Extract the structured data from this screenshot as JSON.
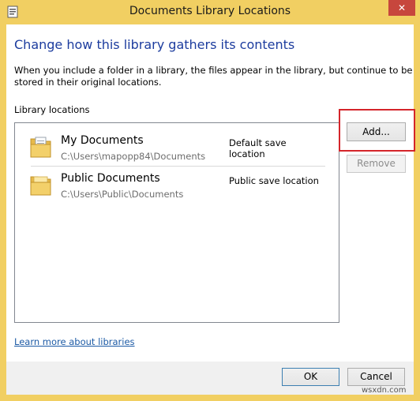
{
  "window": {
    "title": "Documents Library Locations",
    "close_glyph": "✕"
  },
  "heading": "Change how this library gathers its contents",
  "description": "When you include a folder in a library, the files appear in the library, but continue to be stored in their original locations.",
  "library_label": "Library locations",
  "locations": [
    {
      "name": "My Documents",
      "path": "C:\\Users\\mapopp84\\Documents",
      "status": "Default save location",
      "icon": "folder-documents-icon"
    },
    {
      "name": "Public Documents",
      "path": "C:\\Users\\Public\\Documents",
      "status": "Public save location",
      "icon": "folder-icon"
    }
  ],
  "buttons": {
    "add": "Add...",
    "remove": "Remove",
    "ok": "OK",
    "cancel": "Cancel"
  },
  "learn_more_link": "Learn more about libraries",
  "watermark": "wsxdn.com",
  "colors": {
    "titlebar": "#f1cf62",
    "heading": "#1c3c9e",
    "link": "#1c5aa5",
    "close": "#c7463d",
    "highlight": "#d4252a"
  }
}
